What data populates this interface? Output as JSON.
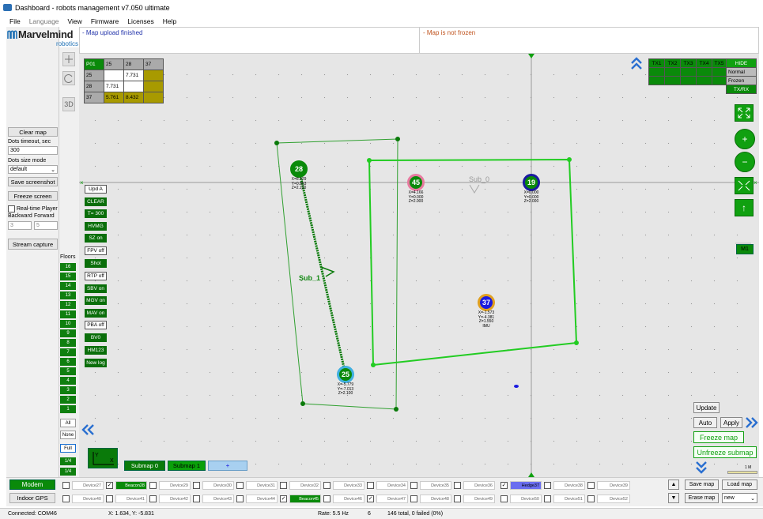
{
  "window": {
    "title": "Dashboard - robots management   v7.050  ultimate"
  },
  "menu": [
    "File",
    "Language",
    "View",
    "Firmware",
    "Licenses",
    "Help"
  ],
  "logo": {
    "name": "Marvelmind",
    "sub": "robotics"
  },
  "left": {
    "clear_map": "Clear map",
    "dots_timeout_label": "Dots timeout, sec",
    "dots_timeout_value": "300",
    "dots_size_label": "Dots size mode",
    "dots_size_value": "default",
    "save_screenshot": "Save screenshot",
    "freeze_screen": "Freeze screen",
    "realtime_player": "Real-time Player",
    "backward_label": "Backward",
    "forward_label": "Forward",
    "backward_value": "3",
    "forward_value": "5",
    "stream_capture": "Stream capture"
  },
  "tools": {
    "view3d": "3D"
  },
  "floors": {
    "label": "Floors",
    "items": [
      "16",
      "15",
      "14",
      "13",
      "12",
      "11",
      "10",
      "9",
      "8",
      "7",
      "6",
      "5",
      "4",
      "3",
      "2",
      "1"
    ],
    "all": "All",
    "none": "None",
    "full": "Full",
    "q1": "1/4",
    "q2": "1/4"
  },
  "header": {
    "left_msg": "- Map upload finished",
    "right_msg": "- Map is not frozen"
  },
  "distance_table": {
    "headers": [
      "P01",
      "25",
      "28",
      "37"
    ],
    "rows": [
      [
        "25",
        "",
        "7.731",
        ""
      ],
      [
        "28",
        "7.731",
        "",
        ""
      ],
      [
        "37",
        "5.761",
        "8.432",
        ""
      ]
    ]
  },
  "green_buttons": [
    {
      "label": "Upd A",
      "on": false
    },
    {
      "label": "CLEAR",
      "on": true
    },
    {
      "label": "T= 300",
      "on": true
    },
    {
      "label": "HVMG",
      "on": true
    },
    {
      "label": "SZ on",
      "on": true
    },
    {
      "label": "FPV off",
      "on": false
    },
    {
      "label": "Shot",
      "on": true
    },
    {
      "label": "RTP off",
      "on": false
    },
    {
      "label": "SBV on",
      "on": true
    },
    {
      "label": "MGV on",
      "on": true
    },
    {
      "label": "MAV on",
      "on": true
    },
    {
      "label": "PBA off",
      "on": false
    },
    {
      "label": "BV0",
      "on": true
    },
    {
      "label": "HM123",
      "on": true
    },
    {
      "label": "New log",
      "on": true
    }
  ],
  "tx": {
    "headers": [
      "TX1",
      "TX2",
      "TX3",
      "TX4",
      "TX5",
      "HIDE"
    ],
    "modes": [
      "Normal",
      "Frozen",
      "TX/RX"
    ]
  },
  "m1": "M1",
  "beacons": [
    {
      "id": "28",
      "coords": [
        "X=8.429",
        "Y=0.853",
        "Z=2.100"
      ],
      "color": "#0a8a0a",
      "ring": "#0a8a0a"
    },
    {
      "id": "45",
      "coords": [
        "X=4.166",
        "Y=0.000",
        "Z=2.000"
      ],
      "color": "#0a8a0a",
      "ring": "#e87aa0"
    },
    {
      "id": "19",
      "coords": [
        "X=0.000",
        "Y=0.000",
        "Z=2.000"
      ],
      "color": "#0a8a0a",
      "ring": "#1a1aa0"
    },
    {
      "id": "37",
      "coords": [
        "X=-1.573",
        "Y=-4.381",
        "Z=1.550",
        "IMU"
      ],
      "color": "#1a1ae0",
      "ring": "#e0a020"
    },
    {
      "id": "25",
      "coords": [
        "X=-5.779",
        "Y=-7.013",
        "Z=2.100"
      ],
      "color": "#0a8a0a",
      "ring": "#40b0e0"
    }
  ],
  "submaps": {
    "sub0": "Sub_0",
    "sub1": "Sub_1"
  },
  "submap_tabs": [
    "Submap 0",
    "Submap 1",
    "+"
  ],
  "right_controls": {
    "update": "Update",
    "auto": "Auto",
    "apply": "Apply",
    "freeze_map": "Freeze map",
    "unfreeze_submap": "Unfreeze submap",
    "scale": "1 M"
  },
  "bottom": {
    "modem": "Modem",
    "indoor_gps": "Indoor GPS",
    "row1": [
      {
        "label": "Device27",
        "checked": false,
        "active": false
      },
      {
        "label": "Beacon28",
        "checked": true,
        "active": true
      },
      {
        "label": "Device29",
        "checked": false,
        "active": false
      },
      {
        "label": "Device30",
        "checked": false,
        "active": false
      },
      {
        "label": "Device31",
        "checked": false,
        "active": false
      },
      {
        "label": "Device32",
        "checked": false,
        "active": false
      },
      {
        "label": "Device33",
        "checked": false,
        "active": false
      },
      {
        "label": "Device34",
        "checked": false,
        "active": false
      },
      {
        "label": "Device35",
        "checked": false,
        "active": false
      },
      {
        "label": "Device36",
        "checked": false,
        "active": false
      },
      {
        "label": "Hedge37",
        "checked": true,
        "active": true,
        "hedge": true
      },
      {
        "label": "Device38",
        "checked": false,
        "active": false
      },
      {
        "label": "Device39",
        "checked": false,
        "active": false
      }
    ],
    "row2": [
      {
        "label": "Device40",
        "checked": false,
        "active": false
      },
      {
        "label": "Device41",
        "checked": false,
        "active": false
      },
      {
        "label": "Device42",
        "checked": false,
        "active": false
      },
      {
        "label": "Device43",
        "checked": false,
        "active": false
      },
      {
        "label": "Device44",
        "checked": false,
        "active": false
      },
      {
        "label": "Beacon45",
        "checked": true,
        "active": true
      },
      {
        "label": "Device46",
        "checked": false,
        "active": false
      },
      {
        "label": "Device47",
        "checked": true,
        "active": false
      },
      {
        "label": "Device48",
        "checked": false,
        "active": false
      },
      {
        "label": "Device49",
        "checked": false,
        "active": false
      },
      {
        "label": "Device50",
        "checked": false,
        "active": false
      },
      {
        "label": "Device51",
        "checked": false,
        "active": false
      },
      {
        "label": "Device52",
        "checked": false,
        "active": false
      }
    ],
    "save_map": "Save map",
    "load_map": "Load map",
    "erase_map": "Erase map",
    "map_select": "new"
  },
  "status": {
    "connected": "Connected: COM46",
    "coords": "X: 1.634, Y: -5.831",
    "rate": "Rate: 5.5 Hz",
    "count": "6",
    "total": "146 total, 0 failed (0%)"
  }
}
